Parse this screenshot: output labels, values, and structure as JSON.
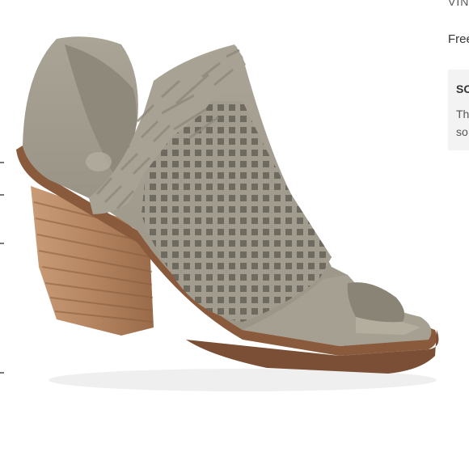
{
  "product": {
    "image_alt": "Taupe perforated suede peep-toe bootie with woven vamp and stacked wood heel"
  },
  "sidebar": {
    "brand_fragment": "VIN",
    "shipping_fragment": "Free",
    "panel_heading_fragment": "SC",
    "panel_text_line1": "Th",
    "panel_text_line2": "so"
  },
  "colors": {
    "suede": "#a39d8f",
    "suede_shadow": "#8d887b",
    "heel_wood": "#b07e58",
    "sole": "#7a4f35"
  }
}
